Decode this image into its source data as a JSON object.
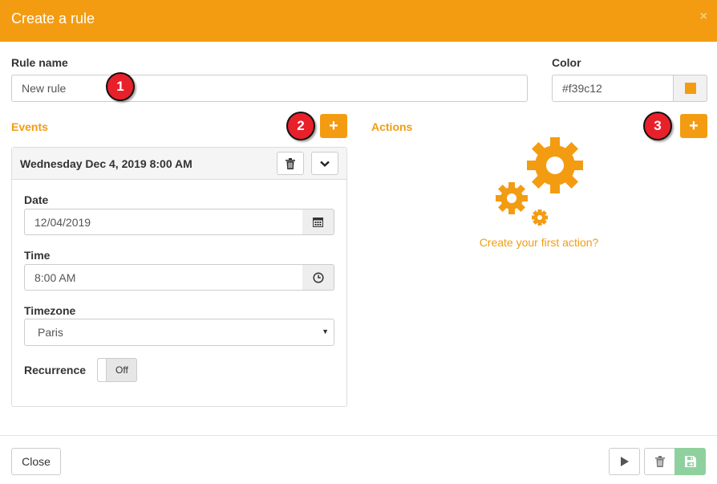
{
  "dialog": {
    "title": "Create a rule",
    "close_glyph": "×"
  },
  "rule_name": {
    "label": "Rule name",
    "value": "New rule"
  },
  "color": {
    "label": "Color",
    "value": "#f39c12",
    "swatch": "#f39c12"
  },
  "events": {
    "title": "Events",
    "add_label": "+",
    "item": {
      "heading": "Wednesday Dec 4, 2019 8:00 AM",
      "date_label": "Date",
      "date_value": "12/04/2019",
      "time_label": "Time",
      "time_value": "8:00 AM",
      "timezone_label": "Timezone",
      "timezone_value": "Paris",
      "recurrence_label": "Recurrence",
      "recurrence_value": "Off"
    }
  },
  "actions": {
    "title": "Actions",
    "add_label": "+",
    "empty_text": "Create your first action?"
  },
  "badges": [
    "1",
    "2",
    "3"
  ],
  "footer": {
    "close_label": "Close"
  },
  "colors": {
    "accent": "#f39c12",
    "badge": "#e8202a",
    "save": "#8fd19e"
  },
  "icons": [
    "trash-icon",
    "chevron-down-icon",
    "calendar-icon",
    "clock-icon",
    "gears-icon",
    "play-icon",
    "save-icon"
  ]
}
